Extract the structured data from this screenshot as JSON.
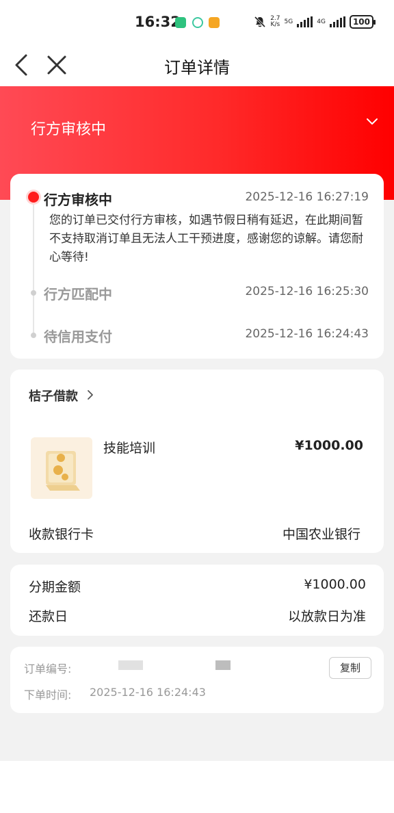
{
  "status_bar": {
    "time": "16:32",
    "network_speed_top": "2.7",
    "network_speed_bottom": "K/s",
    "sim1": "5G",
    "sim2": "4G",
    "battery": "100",
    "app_icon_colors": [
      "#2ec27e",
      "#3cc8a0",
      "#f5a623"
    ]
  },
  "nav": {
    "title": "订单详情"
  },
  "header": {
    "status_title": "行方审核中",
    "background_colors": [
      "#ff4a55",
      "#ff0000"
    ]
  },
  "timeline": [
    {
      "label": "行方审核中",
      "time": "2025-12-16 16:27:19",
      "active": true,
      "description": "您的订单已交付行方审核，如遇节假日稍有延迟，在此期间暂不支持取消订单且无法人工干预进度，感谢您的谅解。请您耐心等待!"
    },
    {
      "label": "行方匹配中",
      "time": "2025-12-16 16:25:30",
      "active": false
    },
    {
      "label": "待信用支付",
      "time": "2025-12-16 16:24:43",
      "active": false
    }
  ],
  "lender": {
    "name": "桔子借款",
    "product_name": "技能培训",
    "price": "¥1000.00",
    "bank_label": "收款银行卡",
    "bank_value": "中国农业银行"
  },
  "amount": {
    "installment_label": "分期金额",
    "installment_value": "¥1000.00",
    "repayment_label": "还款日",
    "repayment_value": "以放款日为准"
  },
  "order": {
    "number_label": "订单编号:",
    "time_label": "下单时间:",
    "time_value": "2025-12-16 16:24:43",
    "copy_label": "复制"
  },
  "colors": {
    "accent_red": "#ff1d1d",
    "text_dark": "#222222",
    "text_muted": "#999999"
  }
}
